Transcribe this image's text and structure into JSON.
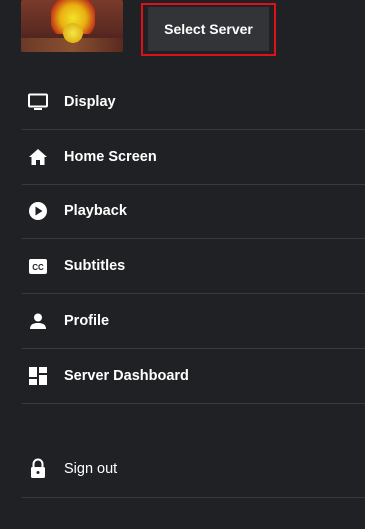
{
  "header": {
    "avatar_alt": "user avatar image",
    "select_server_label": "Select Server"
  },
  "menu": {
    "items": [
      {
        "label": "Display",
        "icon": "monitor-icon"
      },
      {
        "label": "Home Screen",
        "icon": "home-icon"
      },
      {
        "label": "Playback",
        "icon": "play-circle-icon"
      },
      {
        "label": "Subtitles",
        "icon": "closed-captions-icon"
      },
      {
        "label": "Profile",
        "icon": "person-icon"
      },
      {
        "label": "Server Dashboard",
        "icon": "dashboard-icon"
      }
    ],
    "signout_label": "Sign out"
  },
  "colors": {
    "background": "#202124",
    "highlight_border": "#e0101a",
    "button_bg": "#333437"
  }
}
